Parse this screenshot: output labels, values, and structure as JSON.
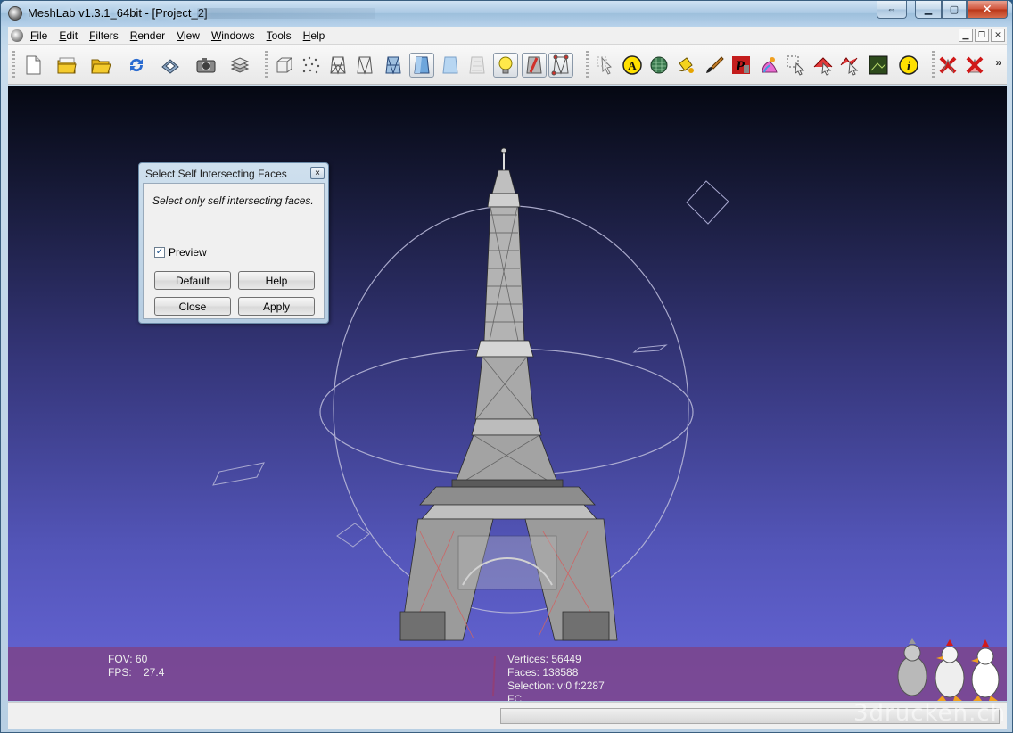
{
  "window": {
    "title": "MeshLab v1.3.1_64bit - [Project_2]"
  },
  "menubar": {
    "items": [
      "File",
      "Edit",
      "Filters",
      "Render",
      "View",
      "Windows",
      "Tools",
      "Help"
    ]
  },
  "toolbar": {
    "more_label": "»",
    "tools": [
      "new-document-icon",
      "open-project-icon",
      "open-folder-icon",
      "reload-icon",
      "save-icon",
      "snapshot-icon",
      "layers-icon",
      "bounding-box-icon",
      "points-icon",
      "wireframe-icon",
      "hidden-lines-icon",
      "flat-lines-icon",
      "flat-icon",
      "smooth-icon",
      "texture-icon",
      "light-bulb-icon",
      "backface-icon",
      "selected-faces-icon",
      "manipulator-icon",
      "annotation-icon",
      "color-mesh-icon",
      "paint-bucket-icon",
      "paintbrush-icon",
      "pickpoints-icon",
      "align-icon",
      "select-vertices-icon",
      "select-faces-icon",
      "select-connected-icon",
      "raster-icon",
      "info-icon",
      "delete-vertices-icon",
      "delete-faces-icon"
    ]
  },
  "dialog": {
    "title": "Select Self Intersecting Faces",
    "close_label": "×",
    "description": "Select only self intersecting faces.",
    "preview_label": "Preview",
    "preview_checked": true,
    "check_mark": "✓",
    "buttons": {
      "default": "Default",
      "help": "Help",
      "close": "Close",
      "apply": "Apply"
    }
  },
  "viewport": {
    "fov_label": "FOV: 60",
    "fps_label": "FPS:    27.4",
    "vertices_label": "Vertices: 56449",
    "faces_label": "Faces: 138588",
    "selection_label": "Selection: v:0 f:2287",
    "fc_label": "FC"
  },
  "watermark": "3drucken.ch",
  "colors": {
    "info_bar": "#804080",
    "sky_top": "#050812",
    "sky_bottom": "#6766d8"
  }
}
